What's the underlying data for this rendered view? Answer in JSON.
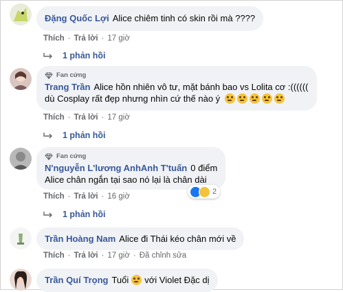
{
  "labels": {
    "fan": "Fan cứng",
    "like": "Thích",
    "reply": "Trả lời",
    "edited": "Đã chỉnh sửa"
  },
  "comments": [
    {
      "name": "Đặng Quốc Lợi",
      "text": "Alice chiêm tinh có skin rồi mà ????",
      "time": "17 giờ",
      "replies": "1 phản hồi"
    },
    {
      "name": "Trang Trần",
      "text": "Alice hồn nhiên vô tư, mặt bánh bao vs Lolita cơ :((((((",
      "text2": "dù Cosplay rất đẹp nhưng nhìn cứ thế nào ý",
      "emoji_count": 5,
      "time": "17 giờ",
      "replies": "1 phản hồi"
    },
    {
      "name": "N'nguyễn L'lương AnhAnh T'tuấn",
      "text": "0 điểm",
      "text2": "Alice chân ngắn tại sao nó lại là chân dài",
      "time": "16 giờ",
      "reaction_count": "2",
      "replies": "1 phản hồi"
    },
    {
      "name": "Trần Hoàng Nam",
      "text": "Alice đi Thái kéo chân mới về",
      "time": "17 giờ"
    },
    {
      "name": "Trần Quí Trọng",
      "text": "Tuổi",
      "text_after": "với Violet Đặc dị"
    }
  ],
  "colors": {
    "name": "#385898",
    "meta": "#65676b",
    "bubble": "#f0f2f5"
  }
}
